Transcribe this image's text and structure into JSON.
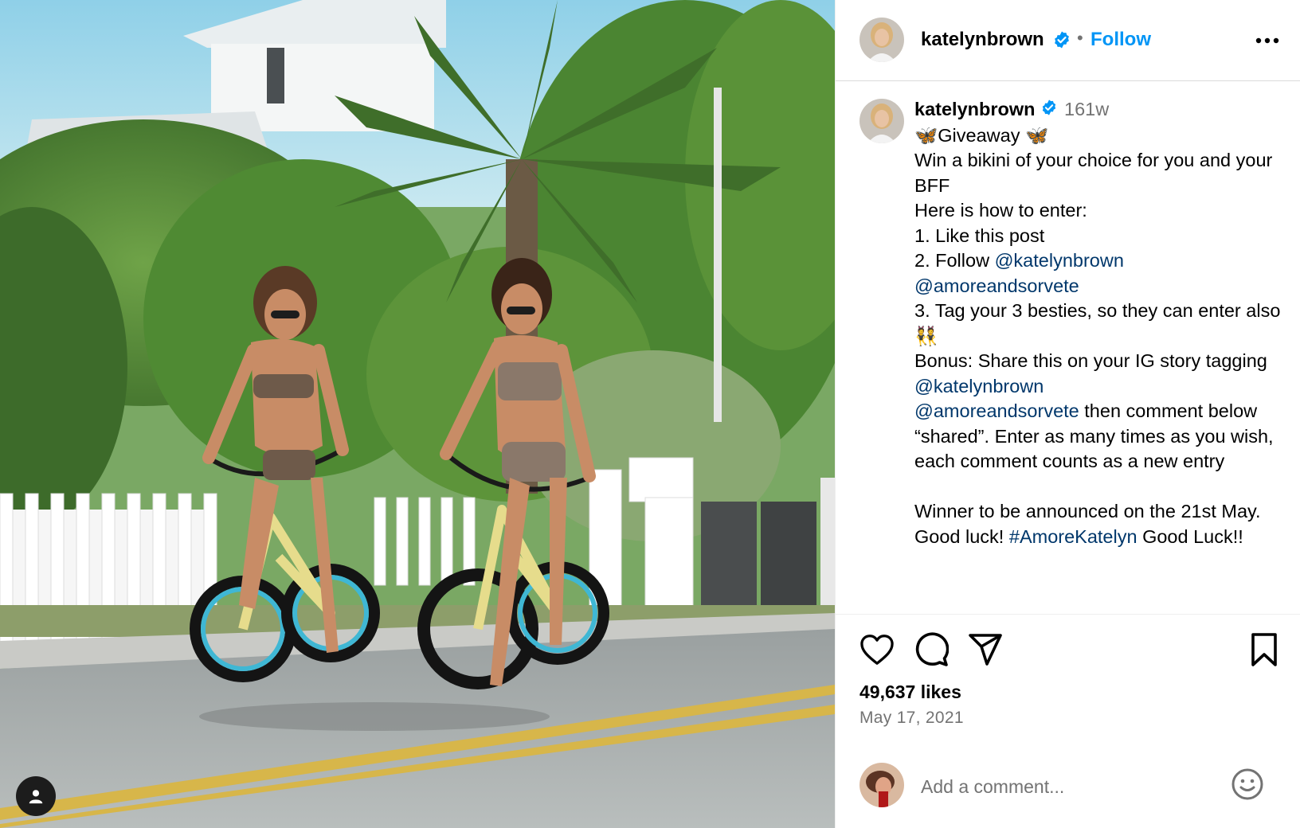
{
  "post": {
    "username": "katelynbrown",
    "follow_label": "Follow",
    "separator": "•",
    "time_ago": "161w",
    "caption": {
      "line_giveaway": "🦋Giveaway 🦋",
      "line_1": "Win a bikini of your choice for you and your BFF",
      "line_2": "Here is how to enter:",
      "line_3": "1. Like this post",
      "line_4_prefix": "2. Follow ",
      "mention_1": "@katelynbrown",
      "mention_2": "@amoreandsorvete",
      "line_5": "3. Tag your 3 besties, so they can enter also 👯",
      "line_6_prefix": "Bonus: Share this on your IG story tagging ",
      "mention_3": "@katelynbrown",
      "mention_4": "@amoreandsorvete",
      "line_6_suffix": " then comment below “shared”. Enter as many times as you wish, each comment counts as a new entry",
      "line_7_prefix": "Winner to be announced on the 21st May. Good luck! ",
      "hashtag": "#AmoreKatelyn",
      "line_7_suffix": " Good Luck!!"
    },
    "likes": "49,637 likes",
    "date": "May 17, 2021",
    "comment_placeholder": "Add a comment..."
  },
  "icons": {
    "tag": "user-tag-icon",
    "verified": "verified-badge-icon",
    "more": "more-dots-icon",
    "like": "heart-icon",
    "comment": "comment-bubble-icon",
    "share": "paper-plane-icon",
    "save": "bookmark-icon",
    "emoji": "smiley-icon"
  },
  "colors": {
    "follow": "#0095f6",
    "link": "#00376b",
    "secondary_text": "#737373",
    "verified": "#0095f6"
  }
}
